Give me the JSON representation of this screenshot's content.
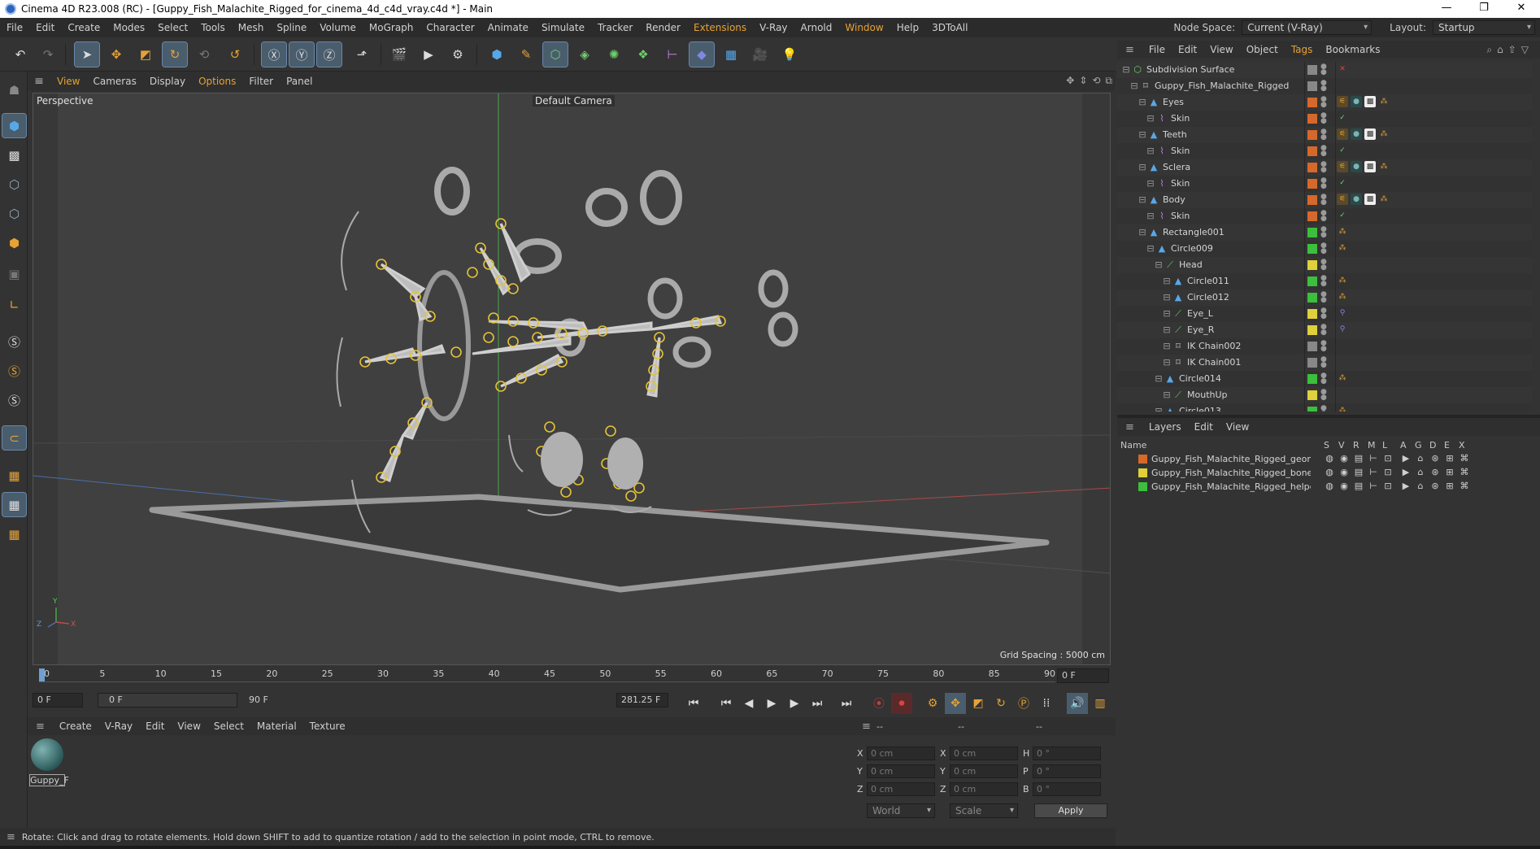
{
  "window": {
    "title": "Cinema 4D R23.008 (RC) - [Guppy_Fish_Malachite_Rigged_for_cinema_4d_c4d_vray.c4d *] - Main",
    "controls": [
      "—",
      "❐",
      "✕"
    ]
  },
  "menubar": {
    "items": [
      "File",
      "Edit",
      "Create",
      "Modes",
      "Select",
      "Tools",
      "Mesh",
      "Spline",
      "Volume",
      "MoGraph",
      "Character",
      "Animate",
      "Simulate",
      "Tracker",
      "Render",
      "Extensions",
      "V-Ray",
      "Arnold",
      "Window",
      "Help",
      "3DToAll"
    ],
    "highlighted": [
      "Extensions",
      "Window"
    ],
    "node_space_label": "Node Space:",
    "node_space_value": "Current (V-Ray)",
    "layout_label": "Layout:",
    "layout_value": "Startup"
  },
  "viewport": {
    "menu": [
      "View",
      "Cameras",
      "Display",
      "Options",
      "Filter",
      "Panel"
    ],
    "highlighted": [
      "View",
      "Options"
    ],
    "view_name": "Perspective",
    "camera": "Default Camera",
    "grid_spacing": "Grid Spacing : 5000 cm",
    "axis_y": "Y",
    "axis_z": "Z",
    "axis_x": "X"
  },
  "timeline": {
    "ticks": [
      "0",
      "5",
      "10",
      "15",
      "20",
      "25",
      "30",
      "35",
      "40",
      "45",
      "50",
      "55",
      "60",
      "65",
      "70",
      "75",
      "80",
      "85",
      "90"
    ],
    "current_frame_field": "0 F",
    "start_field": "0 F",
    "range_start": "0 F",
    "range_end": "90 F",
    "fps_field": "281.25 F",
    "end_field": "0 F"
  },
  "material_manager": {
    "menu": [
      "Create",
      "V-Ray",
      "Edit",
      "View",
      "Select",
      "Material",
      "Texture"
    ],
    "materials": [
      {
        "name": "Guppy_F"
      }
    ]
  },
  "coordinates": {
    "header": [
      "--",
      "--",
      "--"
    ],
    "rows": [
      {
        "a": "X",
        "av": "0 cm",
        "b": "X",
        "bv": "0 cm",
        "c": "H",
        "cv": "0 °"
      },
      {
        "a": "Y",
        "av": "0 cm",
        "b": "Y",
        "bv": "0 cm",
        "c": "P",
        "cv": "0 °"
      },
      {
        "a": "Z",
        "av": "0 cm",
        "b": "Z",
        "bv": "0 cm",
        "c": "B",
        "cv": "0 °"
      }
    ],
    "mode": "World",
    "scale": "Scale",
    "apply": "Apply"
  },
  "object_manager": {
    "menu": [
      "File",
      "Edit",
      "View",
      "Object",
      "Tags",
      "Bookmarks"
    ],
    "highlighted": [
      "Tags"
    ],
    "objects": [
      {
        "name": "Subdivision Surface",
        "indent": 0,
        "icon": "subdivision-icon",
        "color": "#888888",
        "tags": "x"
      },
      {
        "name": "Guppy_Fish_Malachite_Rigged",
        "indent": 1,
        "icon": "null-icon",
        "color": "#888888",
        "tags": ""
      },
      {
        "name": "Eyes",
        "indent": 2,
        "icon": "polygon-icon",
        "color": "#d4692b",
        "tags": "mat"
      },
      {
        "name": "Skin",
        "indent": 3,
        "icon": "skin-icon",
        "color": "#d4692b",
        "tags": "check"
      },
      {
        "name": "Teeth",
        "indent": 2,
        "icon": "polygon-icon",
        "color": "#d4692b",
        "tags": "mat"
      },
      {
        "name": "Skin",
        "indent": 3,
        "icon": "skin-icon",
        "color": "#d4692b",
        "tags": "check"
      },
      {
        "name": "Sclera",
        "indent": 2,
        "icon": "polygon-icon",
        "color": "#d4692b",
        "tags": "mat"
      },
      {
        "name": "Skin",
        "indent": 3,
        "icon": "skin-icon",
        "color": "#d4692b",
        "tags": "check"
      },
      {
        "name": "Body",
        "indent": 2,
        "icon": "polygon-icon",
        "color": "#d4692b",
        "tags": "mat"
      },
      {
        "name": "Skin",
        "indent": 3,
        "icon": "skin-icon",
        "color": "#d4692b",
        "tags": "check"
      },
      {
        "name": "Rectangle001",
        "indent": 2,
        "icon": "spline-icon",
        "color": "#3cbf3c",
        "tags": "dots"
      },
      {
        "name": "Circle009",
        "indent": 3,
        "icon": "spline-icon",
        "color": "#3cbf3c",
        "tags": "dots"
      },
      {
        "name": "Head",
        "indent": 4,
        "icon": "joint-icon",
        "color": "#e0d03a",
        "tags": ""
      },
      {
        "name": "Circle011",
        "indent": 5,
        "icon": "spline-icon",
        "color": "#3cbf3c",
        "tags": "dots"
      },
      {
        "name": "Circle012",
        "indent": 5,
        "icon": "spline-icon",
        "color": "#3cbf3c",
        "tags": "dots"
      },
      {
        "name": "Eye_L",
        "indent": 5,
        "icon": "joint-icon",
        "color": "#e0d03a",
        "tags": "ik"
      },
      {
        "name": "Eye_R",
        "indent": 5,
        "icon": "joint-icon",
        "color": "#e0d03a",
        "tags": "ik"
      },
      {
        "name": "IK Chain002",
        "indent": 5,
        "icon": "ik-icon",
        "color": "#888888",
        "tags": ""
      },
      {
        "name": "IK Chain001",
        "indent": 5,
        "icon": "ik-icon",
        "color": "#888888",
        "tags": ""
      },
      {
        "name": "Circle014",
        "indent": 4,
        "icon": "spline-icon",
        "color": "#3cbf3c",
        "tags": "dots"
      },
      {
        "name": "MouthUp",
        "indent": 5,
        "icon": "joint-icon",
        "color": "#e0d03a",
        "tags": ""
      },
      {
        "name": "Circle013",
        "indent": 4,
        "icon": "spline-icon",
        "color": "#3cbf3c",
        "tags": "dots"
      }
    ]
  },
  "layer_manager": {
    "menu": [
      "Layers",
      "Edit",
      "View"
    ],
    "columns": [
      "Name",
      "S",
      "V",
      "R",
      "M",
      "L",
      "A",
      "G",
      "D",
      "E",
      "X"
    ],
    "layers": [
      {
        "name": "Guppy_Fish_Malachite_Rigged_geometry",
        "color": "#d4692b"
      },
      {
        "name": "Guppy_Fish_Malachite_Rigged_bones",
        "color": "#e0d03a"
      },
      {
        "name": "Guppy_Fish_Malachite_Rigged_helpers",
        "color": "#3cbf3c"
      }
    ]
  },
  "status": {
    "text": "Rotate: Click and drag to rotate elements. Hold down SHIFT to add to quantize rotation / add to the selection in point mode, CTRL to remove."
  }
}
